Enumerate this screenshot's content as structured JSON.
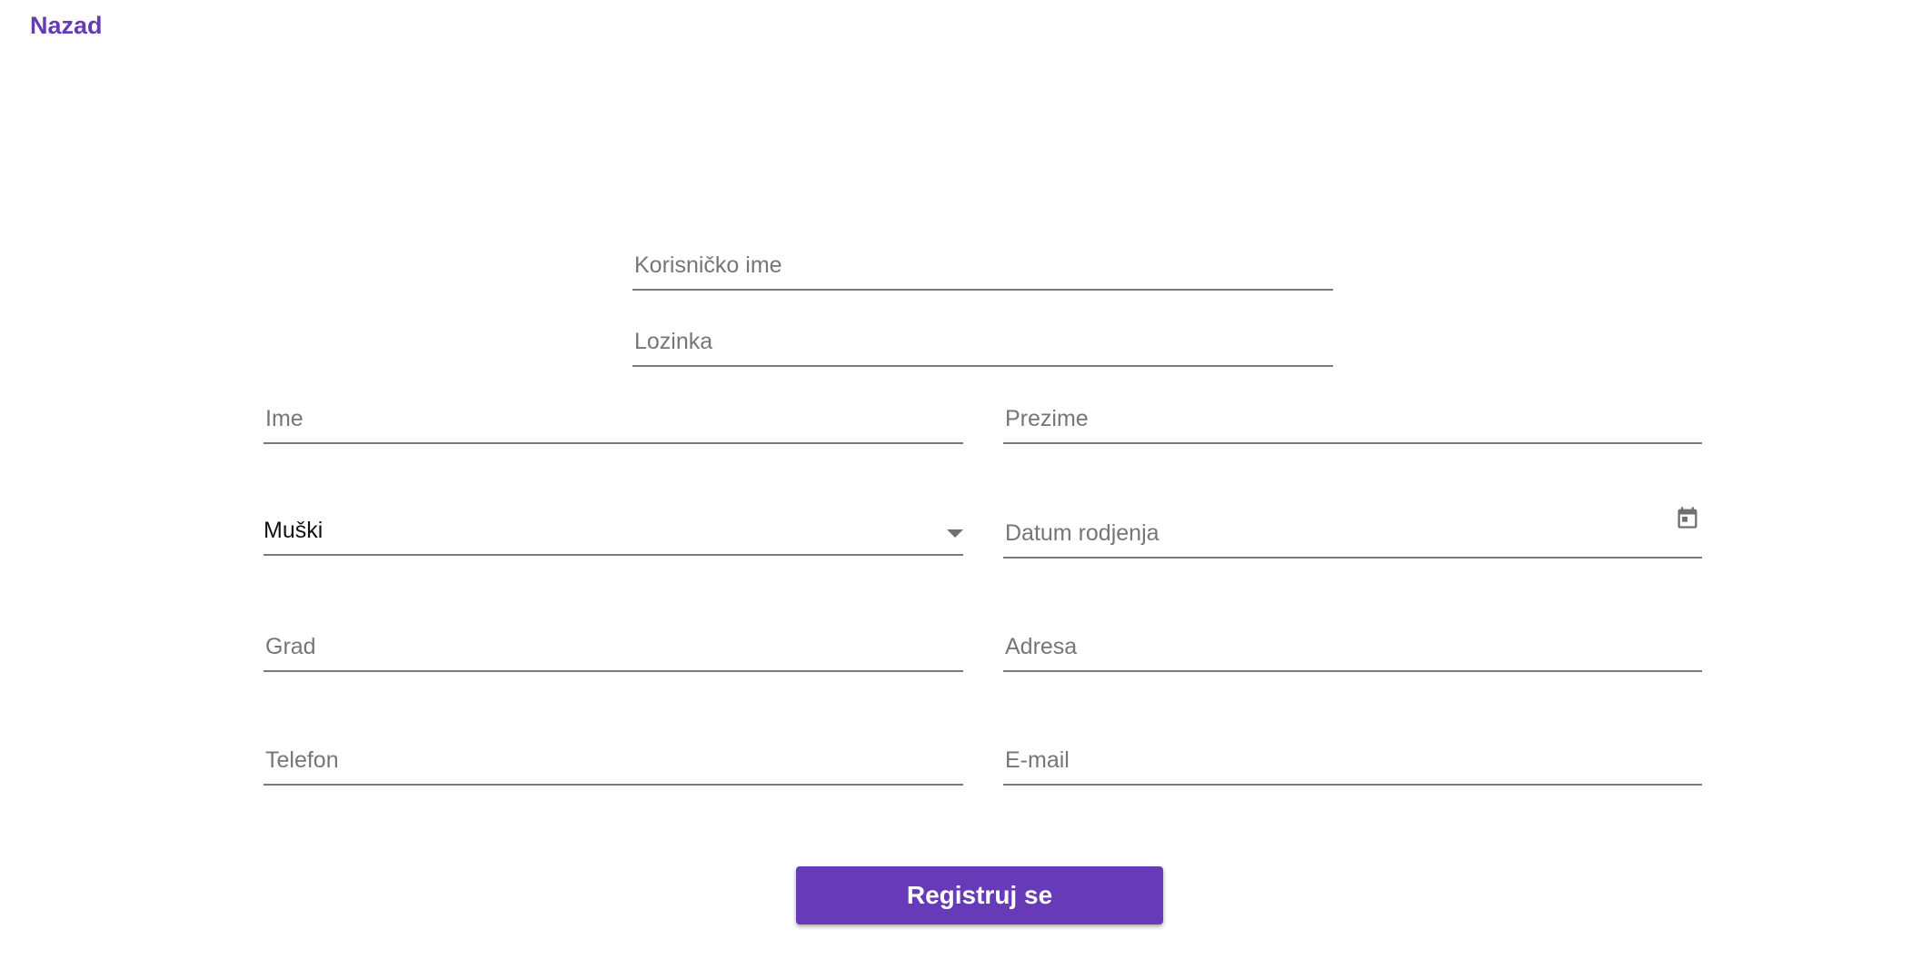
{
  "header": {
    "back_label": "Nazad"
  },
  "form": {
    "username": {
      "placeholder": "Korisničko ime",
      "value": ""
    },
    "password": {
      "placeholder": "Lozinka",
      "value": ""
    },
    "first_name": {
      "placeholder": "Ime",
      "value": ""
    },
    "last_name": {
      "placeholder": "Prezime",
      "value": ""
    },
    "gender": {
      "selected": "Muški"
    },
    "birth_date": {
      "placeholder": "Datum rodjenja",
      "value": ""
    },
    "city": {
      "placeholder": "Grad",
      "value": ""
    },
    "address": {
      "placeholder": "Adresa",
      "value": ""
    },
    "phone": {
      "placeholder": "Telefon",
      "value": ""
    },
    "email": {
      "placeholder": "E-mail",
      "value": ""
    },
    "submit_label": "Registruj se"
  },
  "icons": {
    "gender_dropdown": "chevron-down-icon",
    "birth_date_picker": "calendar-icon"
  },
  "colors": {
    "accent": "#673ab7",
    "underline": "#7a7a7a",
    "placeholder": "#767676",
    "button_text": "#ffffff"
  }
}
